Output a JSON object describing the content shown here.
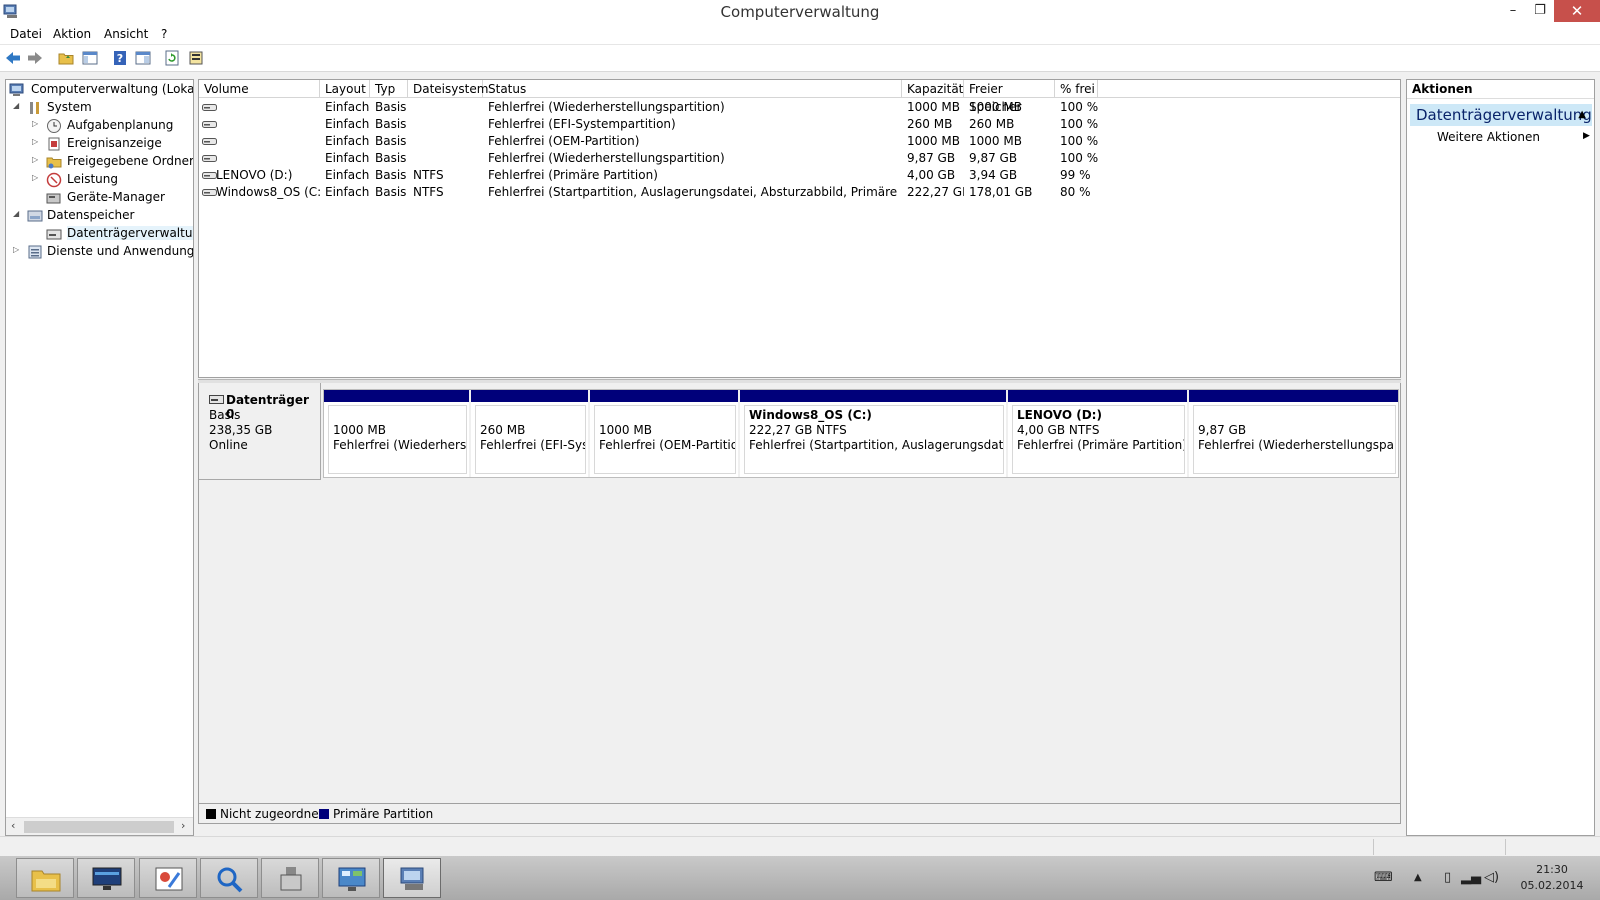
{
  "window": {
    "title": "Computerverwaltung",
    "minimize": "–",
    "maximize": "❐",
    "close": "✕"
  },
  "menu": {
    "items": [
      "Datei",
      "Aktion",
      "Ansicht",
      "?"
    ]
  },
  "tree": {
    "items": [
      {
        "label": "Computerverwaltung (Lokal)",
        "twisty": ""
      },
      {
        "label": "System",
        "twisty": "◢"
      },
      {
        "label": "Aufgabenplanung",
        "twisty": "▷"
      },
      {
        "label": "Ereignisanzeige",
        "twisty": "▷"
      },
      {
        "label": "Freigegebene Ordner",
        "twisty": "▷"
      },
      {
        "label": "Leistung",
        "twisty": "▷"
      },
      {
        "label": "Geräte-Manager",
        "twisty": ""
      },
      {
        "label": "Datenspeicher",
        "twisty": "◢"
      },
      {
        "label": "Datenträgerverwaltung",
        "twisty": ""
      },
      {
        "label": "Dienste und Anwendungen",
        "twisty": "▷"
      }
    ],
    "scroll_left": "‹",
    "scroll_right": "›"
  },
  "volumes": {
    "columns": [
      "Volume",
      "Layout",
      "Typ",
      "Dateisystem",
      "Status",
      "Kapazität",
      "Freier Speicher",
      "% frei"
    ],
    "rows": [
      [
        "",
        "Einfach",
        "Basis",
        "",
        "Fehlerfrei (Wiederherstellungspartition)",
        "1000 MB",
        "1000 MB",
        "100 %"
      ],
      [
        "",
        "Einfach",
        "Basis",
        "",
        "Fehlerfrei (EFI-Systempartition)",
        "260 MB",
        "260 MB",
        "100 %"
      ],
      [
        "",
        "Einfach",
        "Basis",
        "",
        "Fehlerfrei (OEM-Partition)",
        "1000 MB",
        "1000 MB",
        "100 %"
      ],
      [
        "",
        "Einfach",
        "Basis",
        "",
        "Fehlerfrei (Wiederherstellungspartition)",
        "9,87 GB",
        "9,87 GB",
        "100 %"
      ],
      [
        "LENOVO (D:)",
        "Einfach",
        "Basis",
        "NTFS",
        "Fehlerfrei (Primäre Partition)",
        "4,00 GB",
        "3,94 GB",
        "99 %"
      ],
      [
        "Windows8_OS (C:)",
        "Einfach",
        "Basis",
        "NTFS",
        "Fehlerfrei (Startpartition, Auslagerungsdatei, Absturzabbild, Primäre Partition)",
        "222,27 GB",
        "178,01 GB",
        "80 %"
      ]
    ]
  },
  "disk": {
    "name": "Datenträger 0",
    "type": "Basis",
    "size": "238,35 GB",
    "state": "Online",
    "partitions": [
      {
        "name": "",
        "size": "1000 MB",
        "status": "Fehlerfrei (Wiederherstellu"
      },
      {
        "name": "",
        "size": "260 MB",
        "status": "Fehlerfrei (EFI-Syster"
      },
      {
        "name": "",
        "size": "1000 MB",
        "status": "Fehlerfrei (OEM-Partition)"
      },
      {
        "name": "Windows8_OS  (C:)",
        "size": "222,27 GB NTFS",
        "status": "Fehlerfrei (Startpartition, Auslagerungsdatei, Abs"
      },
      {
        "name": "LENOVO  (D:)",
        "size": "4,00 GB NTFS",
        "status": "Fehlerfrei (Primäre Partition)"
      },
      {
        "name": "",
        "size": "9,87 GB",
        "status": "Fehlerfrei (Wiederherstellungspartiti"
      }
    ]
  },
  "legend": {
    "unallocated": "Nicht zugeordnet",
    "primary": "Primäre Partition",
    "unallocated_color": "#000000",
    "primary_color": "#00007a"
  },
  "actions": {
    "header": "Aktionen",
    "section": "Datenträgerverwaltung",
    "more": "Weitere Aktionen"
  },
  "taskbar": {
    "clock_time": "21:30",
    "clock_date": "05.02.2014"
  },
  "icons": {
    "app": "computer-management-icon",
    "back": "back-arrow-icon",
    "forward": "forward-arrow-icon"
  }
}
